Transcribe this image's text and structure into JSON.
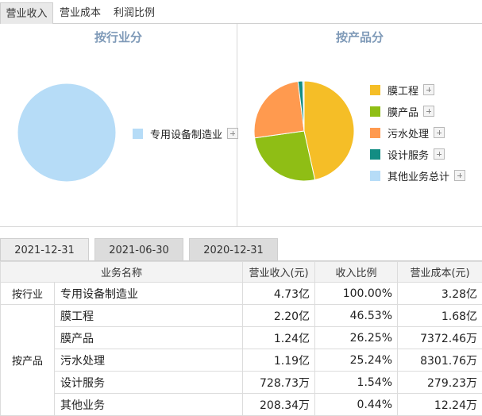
{
  "top_tabs": [
    "营业收入",
    "营业成本",
    "利润比例"
  ],
  "left_panel": {
    "title": "按行业分",
    "legend": [
      {
        "label": "专用设备制造业",
        "color": "#b6dcf7",
        "value": 100.0
      }
    ]
  },
  "right_panel": {
    "title": "按产品分",
    "legend": [
      {
        "label": "膜工程",
        "color": "#f5be27",
        "value": 46.53
      },
      {
        "label": "膜产品",
        "color": "#8fbe15",
        "value": 26.25
      },
      {
        "label": "污水处理",
        "color": "#ff9a4f",
        "value": 25.24
      },
      {
        "label": "设计服务",
        "color": "#138d83",
        "value": 1.54
      },
      {
        "label": "其他业务总计",
        "color": "#b6dcf7",
        "value": 0.44
      }
    ]
  },
  "date_tabs": [
    "2021-12-31",
    "2021-06-30",
    "2020-12-31"
  ],
  "table": {
    "headers": [
      "业务名称",
      "营业收入(元)",
      "收入比例",
      "营业成本(元)"
    ],
    "groups": [
      {
        "label": "按行业",
        "rows": [
          {
            "name": "专用设备制造业",
            "revenue": "4.73亿",
            "ratio": "100.00%",
            "cost": "3.28亿"
          }
        ]
      },
      {
        "label": "按产品",
        "rows": [
          {
            "name": "膜工程",
            "revenue": "2.20亿",
            "ratio": "46.53%",
            "cost": "1.68亿"
          },
          {
            "name": "膜产品",
            "revenue": "1.24亿",
            "ratio": "26.25%",
            "cost": "7372.46万"
          },
          {
            "name": "污水处理",
            "revenue": "1.19亿",
            "ratio": "25.24%",
            "cost": "8301.76万"
          },
          {
            "name": "设计服务",
            "revenue": "728.73万",
            "ratio": "1.54%",
            "cost": "279.23万"
          },
          {
            "name": "其他业务",
            "revenue": "208.34万",
            "ratio": "0.44%",
            "cost": "12.24万"
          }
        ]
      }
    ]
  }
}
